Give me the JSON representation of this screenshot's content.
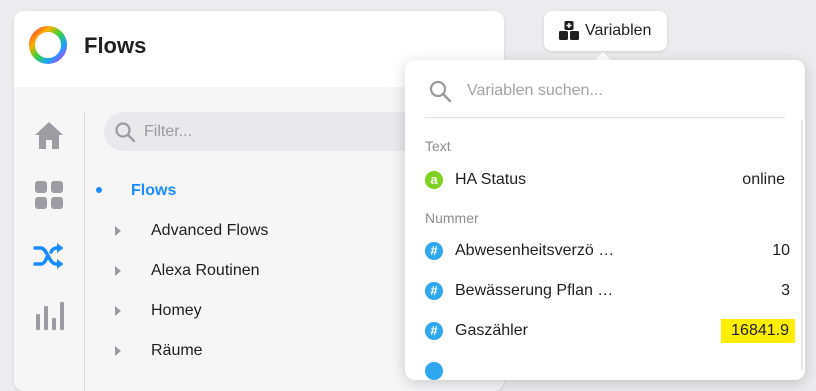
{
  "app": {
    "title": "Flows",
    "logo_icon": "ring-logo-icon"
  },
  "sidebar": {
    "items": [
      {
        "name": "home",
        "icon": "home-icon"
      },
      {
        "name": "dashboard",
        "icon": "grid-icon"
      },
      {
        "name": "flows",
        "icon": "shuffle-icon",
        "active": true
      },
      {
        "name": "insights",
        "icon": "bar-chart-icon"
      }
    ]
  },
  "filter": {
    "placeholder": "Filter..."
  },
  "tree": {
    "root": "Flows",
    "items": [
      "Advanced Flows",
      "Alexa Routinen",
      "Homey",
      "Räume"
    ]
  },
  "variables_button": {
    "label": "Variablen",
    "icon": "blocks-plus-icon"
  },
  "variables_popover": {
    "search_placeholder": "Variablen suchen...",
    "sections": [
      {
        "label": "Text",
        "items": [
          {
            "name": "HA Status",
            "value": "online",
            "badge": "a",
            "badge_color": "#7ed321"
          }
        ]
      },
      {
        "label": "Nummer",
        "items": [
          {
            "name": "Abwesenheitsverzö …",
            "value": "10",
            "badge": "#",
            "badge_color": "#2fa7f0"
          },
          {
            "name": "Bewässerung Pflan …",
            "value": "3",
            "badge": "#",
            "badge_color": "#2fa7f0"
          },
          {
            "name": "Gaszähler",
            "value": "16841.9",
            "badge": "#",
            "badge_color": "#2fa7f0",
            "highlight_color": "#ffee00"
          }
        ]
      }
    ]
  },
  "colors": {
    "accent": "#1a8cff",
    "sidebar_icon": "#9c9ca2",
    "highlight": "#ffee00"
  }
}
